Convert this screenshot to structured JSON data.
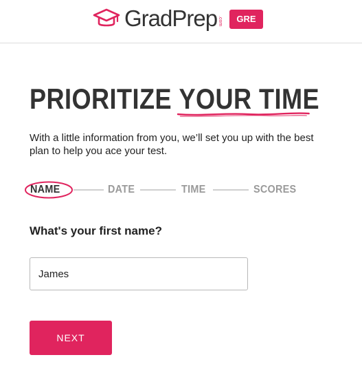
{
  "header": {
    "brand_name": "GradPrep",
    "brand_suffix": ".com",
    "logo_icon": "graduation-cap-icon",
    "exam_badge": "GRE"
  },
  "hero": {
    "headline_part1": "PRIORITIZE ",
    "headline_part2": "YOUR TIME",
    "intro_text": "With a little information from you, we’ll set you up with the best plan to help you ace your test."
  },
  "steps": {
    "items": [
      {
        "label": "NAME",
        "active": true
      },
      {
        "label": "DATE",
        "active": false
      },
      {
        "label": "TIME",
        "active": false
      },
      {
        "label": "SCORES",
        "active": false
      }
    ]
  },
  "form": {
    "question": "What's your first name?",
    "first_name_value": "James",
    "next_label": "NEXT"
  },
  "colors": {
    "accent": "#e0245e",
    "text": "#333333",
    "inactive_step": "#9a9a9a"
  }
}
